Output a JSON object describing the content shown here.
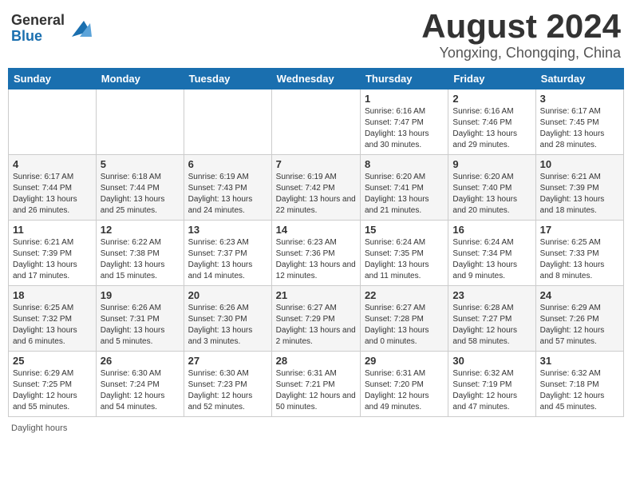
{
  "header": {
    "logo_general": "General",
    "logo_blue": "Blue",
    "month": "August 2024",
    "location": "Yongxing, Chongqing, China"
  },
  "weekdays": [
    "Sunday",
    "Monday",
    "Tuesday",
    "Wednesday",
    "Thursday",
    "Friday",
    "Saturday"
  ],
  "footer": {
    "daylight_label": "Daylight hours"
  },
  "weeks": [
    [
      {
        "day": "",
        "info": ""
      },
      {
        "day": "",
        "info": ""
      },
      {
        "day": "",
        "info": ""
      },
      {
        "day": "",
        "info": ""
      },
      {
        "day": "1",
        "info": "Sunrise: 6:16 AM\nSunset: 7:47 PM\nDaylight: 13 hours and 30 minutes."
      },
      {
        "day": "2",
        "info": "Sunrise: 6:16 AM\nSunset: 7:46 PM\nDaylight: 13 hours and 29 minutes."
      },
      {
        "day": "3",
        "info": "Sunrise: 6:17 AM\nSunset: 7:45 PM\nDaylight: 13 hours and 28 minutes."
      }
    ],
    [
      {
        "day": "4",
        "info": "Sunrise: 6:17 AM\nSunset: 7:44 PM\nDaylight: 13 hours and 26 minutes."
      },
      {
        "day": "5",
        "info": "Sunrise: 6:18 AM\nSunset: 7:44 PM\nDaylight: 13 hours and 25 minutes."
      },
      {
        "day": "6",
        "info": "Sunrise: 6:19 AM\nSunset: 7:43 PM\nDaylight: 13 hours and 24 minutes."
      },
      {
        "day": "7",
        "info": "Sunrise: 6:19 AM\nSunset: 7:42 PM\nDaylight: 13 hours and 22 minutes."
      },
      {
        "day": "8",
        "info": "Sunrise: 6:20 AM\nSunset: 7:41 PM\nDaylight: 13 hours and 21 minutes."
      },
      {
        "day": "9",
        "info": "Sunrise: 6:20 AM\nSunset: 7:40 PM\nDaylight: 13 hours and 20 minutes."
      },
      {
        "day": "10",
        "info": "Sunrise: 6:21 AM\nSunset: 7:39 PM\nDaylight: 13 hours and 18 minutes."
      }
    ],
    [
      {
        "day": "11",
        "info": "Sunrise: 6:21 AM\nSunset: 7:39 PM\nDaylight: 13 hours and 17 minutes."
      },
      {
        "day": "12",
        "info": "Sunrise: 6:22 AM\nSunset: 7:38 PM\nDaylight: 13 hours and 15 minutes."
      },
      {
        "day": "13",
        "info": "Sunrise: 6:23 AM\nSunset: 7:37 PM\nDaylight: 13 hours and 14 minutes."
      },
      {
        "day": "14",
        "info": "Sunrise: 6:23 AM\nSunset: 7:36 PM\nDaylight: 13 hours and 12 minutes."
      },
      {
        "day": "15",
        "info": "Sunrise: 6:24 AM\nSunset: 7:35 PM\nDaylight: 13 hours and 11 minutes."
      },
      {
        "day": "16",
        "info": "Sunrise: 6:24 AM\nSunset: 7:34 PM\nDaylight: 13 hours and 9 minutes."
      },
      {
        "day": "17",
        "info": "Sunrise: 6:25 AM\nSunset: 7:33 PM\nDaylight: 13 hours and 8 minutes."
      }
    ],
    [
      {
        "day": "18",
        "info": "Sunrise: 6:25 AM\nSunset: 7:32 PM\nDaylight: 13 hours and 6 minutes."
      },
      {
        "day": "19",
        "info": "Sunrise: 6:26 AM\nSunset: 7:31 PM\nDaylight: 13 hours and 5 minutes."
      },
      {
        "day": "20",
        "info": "Sunrise: 6:26 AM\nSunset: 7:30 PM\nDaylight: 13 hours and 3 minutes."
      },
      {
        "day": "21",
        "info": "Sunrise: 6:27 AM\nSunset: 7:29 PM\nDaylight: 13 hours and 2 minutes."
      },
      {
        "day": "22",
        "info": "Sunrise: 6:27 AM\nSunset: 7:28 PM\nDaylight: 13 hours and 0 minutes."
      },
      {
        "day": "23",
        "info": "Sunrise: 6:28 AM\nSunset: 7:27 PM\nDaylight: 12 hours and 58 minutes."
      },
      {
        "day": "24",
        "info": "Sunrise: 6:29 AM\nSunset: 7:26 PM\nDaylight: 12 hours and 57 minutes."
      }
    ],
    [
      {
        "day": "25",
        "info": "Sunrise: 6:29 AM\nSunset: 7:25 PM\nDaylight: 12 hours and 55 minutes."
      },
      {
        "day": "26",
        "info": "Sunrise: 6:30 AM\nSunset: 7:24 PM\nDaylight: 12 hours and 54 minutes."
      },
      {
        "day": "27",
        "info": "Sunrise: 6:30 AM\nSunset: 7:23 PM\nDaylight: 12 hours and 52 minutes."
      },
      {
        "day": "28",
        "info": "Sunrise: 6:31 AM\nSunset: 7:21 PM\nDaylight: 12 hours and 50 minutes."
      },
      {
        "day": "29",
        "info": "Sunrise: 6:31 AM\nSunset: 7:20 PM\nDaylight: 12 hours and 49 minutes."
      },
      {
        "day": "30",
        "info": "Sunrise: 6:32 AM\nSunset: 7:19 PM\nDaylight: 12 hours and 47 minutes."
      },
      {
        "day": "31",
        "info": "Sunrise: 6:32 AM\nSunset: 7:18 PM\nDaylight: 12 hours and 45 minutes."
      }
    ]
  ]
}
